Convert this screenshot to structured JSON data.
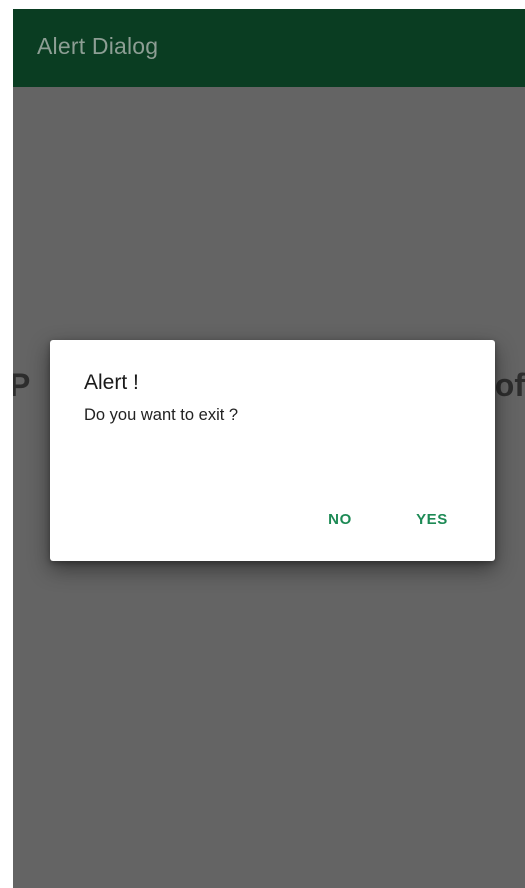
{
  "app_bar": {
    "title": "Alert Dialog"
  },
  "background": {
    "text_left": "P",
    "text_right": "of"
  },
  "dialog": {
    "title": "Alert !",
    "message": "Do you want to exit ?",
    "negative_label": "NO",
    "positive_label": "YES"
  },
  "colors": {
    "app_bar": "#0a3d22",
    "scrim": "#646464",
    "accent": "#1d8a55"
  }
}
